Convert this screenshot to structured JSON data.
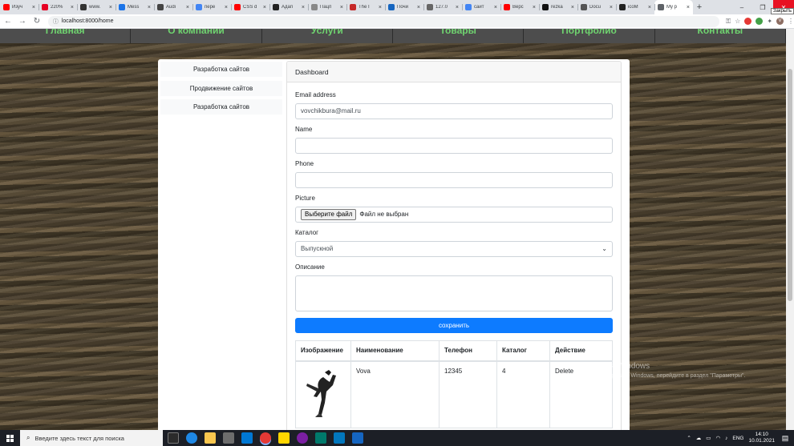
{
  "browser": {
    "tabs": [
      {
        "title": "Изуч",
        "color": "#ff0000"
      },
      {
        "title": "220%",
        "color": "#e60023"
      },
      {
        "title": "www.",
        "color": "#333333"
      },
      {
        "title": "Mess",
        "color": "#1a73e8"
      },
      {
        "title": "Audi",
        "color": "#444444"
      },
      {
        "title": "пере",
        "color": "#4285f4"
      },
      {
        "title": "CSS d",
        "color": "#ff0000"
      },
      {
        "title": "Адап",
        "color": "#222222"
      },
      {
        "title": "Пацп",
        "color": "#888888"
      },
      {
        "title": "The I",
        "color": "#c62828"
      },
      {
        "title": "Почи",
        "color": "#1565c0"
      },
      {
        "title": "127.0",
        "color": "#666666"
      },
      {
        "title": "сайт",
        "color": "#4285f4"
      },
      {
        "title": "Верс",
        "color": "#ff0000"
      },
      {
        "title": "rezka",
        "color": "#111111"
      },
      {
        "title": "Docu",
        "color": "#555555"
      },
      {
        "title": "icoM",
        "color": "#222222"
      },
      {
        "title": "My p",
        "color": "#5f6368"
      }
    ],
    "url": "localhost:8000/home",
    "close_tooltip": "Закрыть",
    "profile_initial": "V"
  },
  "topnav": [
    "Главная",
    "О компании",
    "Услуги",
    "Товары",
    "Портфолио",
    "Контакты"
  ],
  "sidebar": {
    "items": [
      {
        "label": "Разработка сайтов"
      },
      {
        "label": "Продвижение сайтов"
      },
      {
        "label": "Разработка сайтов"
      }
    ]
  },
  "card": {
    "header": "Dashboard",
    "email_label": "Email address",
    "email_value": "vovchikbura@mail.ru",
    "name_label": "Name",
    "name_value": "",
    "phone_label": "Phone",
    "phone_value": "",
    "picture_label": "Picture",
    "file_button": "Выберите файл",
    "file_status": "Файл не выбран",
    "catalog_label": "Каталог",
    "catalog_selected": "Выпускной",
    "description_label": "Описание",
    "save_label": "сохранить"
  },
  "table": {
    "headers": [
      "Изображение",
      "Наименование",
      "Телефон",
      "Каталог",
      "Действие"
    ],
    "rows": [
      {
        "name": "Vova",
        "phone": "12345",
        "catalog": "4",
        "action": "Delete"
      }
    ]
  },
  "watermark": {
    "line1": "Активация Windows",
    "line2": "Чтобы активировать Windows, перейдите в раздел \"Параметры\"."
  },
  "taskbar": {
    "search_placeholder": "Введите здесь текст для поиска",
    "lang": "ENG",
    "time": "14:10",
    "date": "10.01.2021"
  }
}
